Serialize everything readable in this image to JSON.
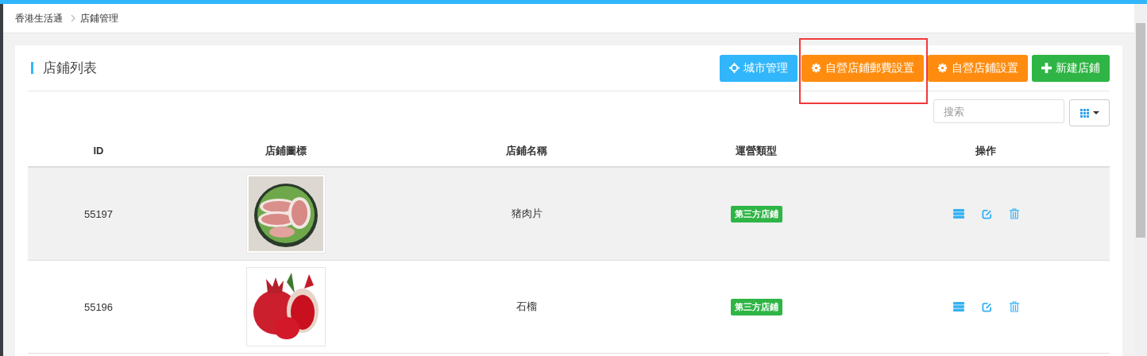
{
  "breadcrumb": [
    {
      "label": "香港生活通"
    },
    {
      "label": "店鋪管理"
    }
  ],
  "panel": {
    "title": "店鋪列表"
  },
  "toolbar": [
    {
      "label": "城市管理",
      "kind": "crosshair",
      "color": "#31b6fb",
      "annotated": false
    },
    {
      "label": "自營店鋪郵費設置",
      "kind": "gear",
      "color": "#ff8c0f",
      "annotated": true
    },
    {
      "label": "自營店鋪設置",
      "kind": "gear",
      "color": "#ff8c0f",
      "annotated": false
    },
    {
      "label": "新建店鋪",
      "kind": "plus",
      "color": "#2fb545",
      "annotated": false
    }
  ],
  "search": {
    "placeholder": "搜索"
  },
  "table": {
    "columns": [
      "ID",
      "店鋪圖標",
      "店鋪名稱",
      "運營類型",
      "操作"
    ],
    "rows": [
      {
        "id": "55197",
        "name": "猪肉片",
        "type": "第三方店鋪",
        "selected": true
      },
      {
        "id": "55196",
        "name": "石榴",
        "type": "第三方店鋪",
        "selected": false
      }
    ]
  }
}
